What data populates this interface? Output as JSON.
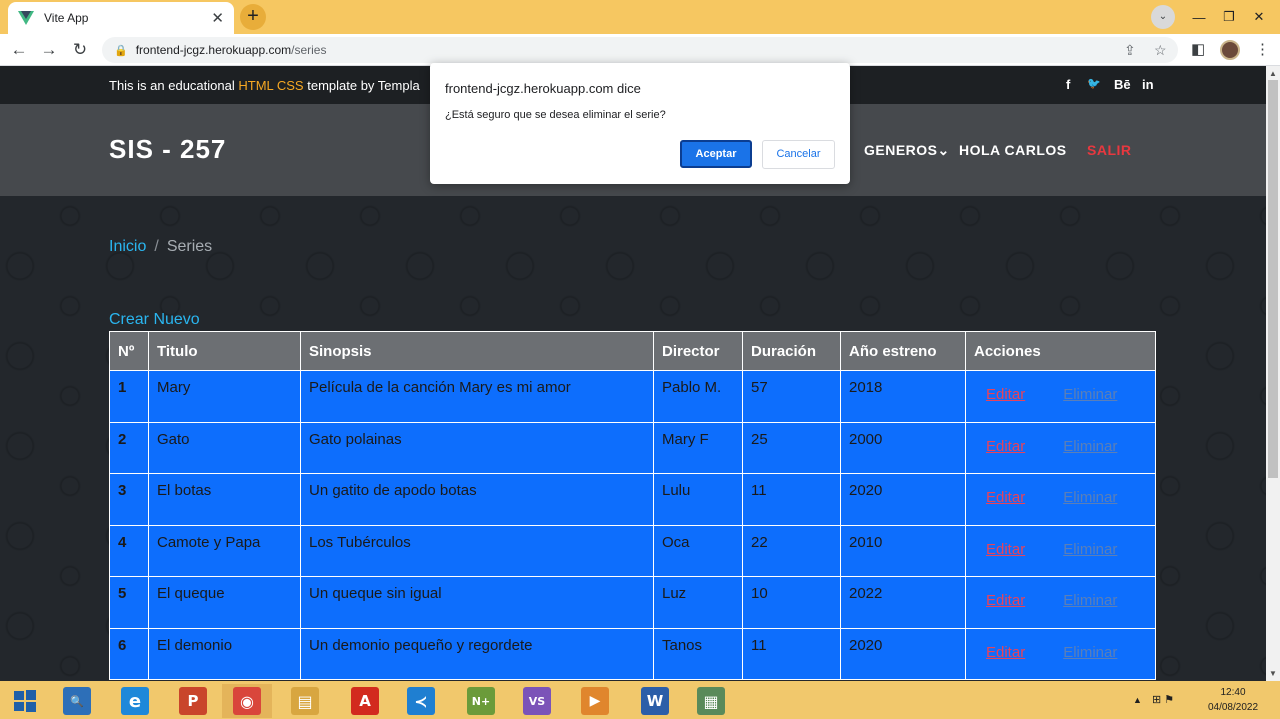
{
  "browser": {
    "tab_title": "Vite App",
    "tab_close": "✕",
    "new_tab": "+",
    "url_host": "frontend-jcgz.herokuapp.com",
    "url_path": "/series",
    "controls": {
      "dropdown": "⌄",
      "minimize": "—",
      "restore": "❐",
      "close": "✕"
    },
    "nav": {
      "back": "←",
      "forward": "→",
      "reload": "↻"
    },
    "icons": {
      "share": "⇪",
      "star": "☆",
      "sidepanel": "◧",
      "menu": "⋮",
      "lock": "🔒"
    }
  },
  "site": {
    "topline_pre": "This is an educational ",
    "topline_hl": "HTML CSS",
    "topline_post": " template by Templa",
    "social": [
      "f",
      "🐦",
      "Bē",
      "in"
    ],
    "brand": "SIS - 257",
    "nav": {
      "generos": "GENEROS⌄",
      "user": "HOLA CARLOS",
      "exit": "SALIR"
    },
    "breadcrumb": {
      "home": "Inicio",
      "sep": "/",
      "current": "Series"
    },
    "create_link": "Crear Nuevo"
  },
  "table": {
    "headers": [
      "Nº",
      "Titulo",
      "Sinopsis",
      "Director",
      "Duración",
      "Año estreno",
      "Acciones"
    ],
    "edit_label": "Editar",
    "delete_label": "Eliminar",
    "rows": [
      [
        "1",
        "Mary",
        "Película de la canción Mary es mi amor",
        "Pablo M.",
        "57",
        "2018"
      ],
      [
        "2",
        "Gato",
        "Gato polainas",
        "Mary F",
        "25",
        "2000"
      ],
      [
        "3",
        "El botas",
        "Un gatito de apodo botas",
        "Lulu",
        "11",
        "2020"
      ],
      [
        "4",
        "Camote y Papa",
        "Los Tubérculos",
        "Oca",
        "22",
        "2010"
      ],
      [
        "5",
        "El queque",
        "Un queque sin igual",
        "Luz",
        "10",
        "2022"
      ],
      [
        "6",
        "El demonio",
        "Un demonio pequeño y regordete",
        "Tanos",
        "11",
        "2020"
      ]
    ]
  },
  "dialog": {
    "title": "frontend-jcgz.herokuapp.com dice",
    "message": "¿Está seguro que se desea eliminar el serie?",
    "ok": "Aceptar",
    "cancel": "Cancelar"
  },
  "taskbar": {
    "apps": [
      {
        "name": "search",
        "glyph": "🔍",
        "color": "#2d6fb8"
      },
      {
        "name": "internet-explorer",
        "glyph": "e",
        "color": "#1e88d9"
      },
      {
        "name": "powerpoint",
        "glyph": "P",
        "color": "#c9452b"
      },
      {
        "name": "chrome",
        "glyph": "◉",
        "color": "#d9463b"
      },
      {
        "name": "file-explorer",
        "glyph": "▤",
        "color": "#d8a640"
      },
      {
        "name": "acrobat",
        "glyph": "A",
        "color": "#d22a1e"
      },
      {
        "name": "vscode",
        "glyph": "≺",
        "color": "#1f7fd1"
      },
      {
        "name": "notepad-plus",
        "glyph": "N+",
        "color": "#6b9b3a"
      },
      {
        "name": "visual-studio",
        "glyph": "VS",
        "color": "#7b53b8"
      },
      {
        "name": "media-player",
        "glyph": "▶",
        "color": "#e0862d"
      },
      {
        "name": "word",
        "glyph": "W",
        "color": "#2b5ea8"
      },
      {
        "name": "app-window",
        "glyph": "▦",
        "color": "#5a8a5a"
      }
    ],
    "tray": {
      "arrow": "▲",
      "icons": "⊞ ⚑"
    },
    "time": "12:40",
    "date": "04/08/2022"
  }
}
